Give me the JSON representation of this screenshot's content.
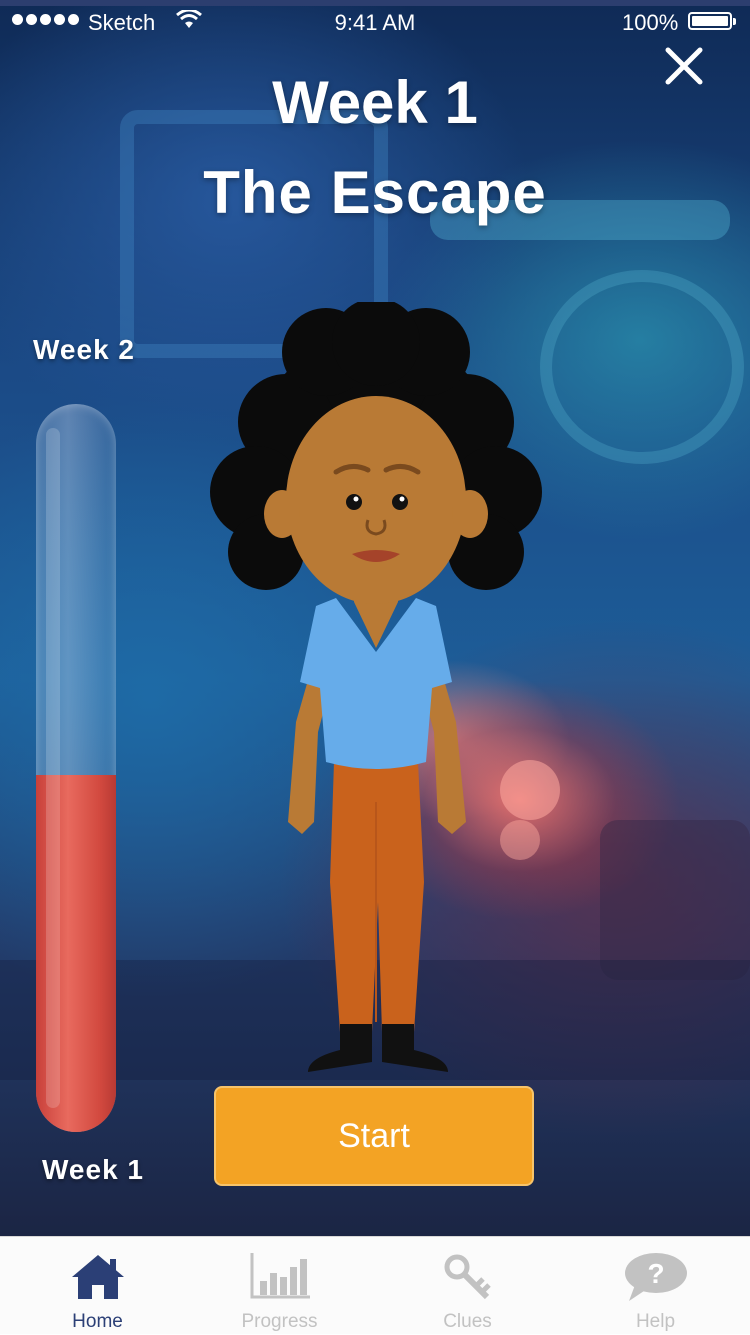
{
  "status_bar": {
    "carrier": "Sketch",
    "time": "9:41 AM",
    "battery": "100%"
  },
  "header": {
    "week": "Week 1",
    "episode": "The Escape"
  },
  "progress": {
    "top_label": "Week 2",
    "bottom_label": "Week 1",
    "fill_fraction": 0.49
  },
  "start_button": {
    "label": "Start"
  },
  "tabs": [
    {
      "label": "Home",
      "icon": "home-icon",
      "active": true
    },
    {
      "label": "Progress",
      "icon": "bar-chart-icon",
      "active": false
    },
    {
      "label": "Clues",
      "icon": "key-icon",
      "active": false
    },
    {
      "label": "Help",
      "icon": "help-bubble-icon",
      "active": false
    }
  ],
  "colors": {
    "accent": "#f3a324",
    "active_tab": "#2b3f76",
    "inactive_tab": "#c2c2c2",
    "progress_fill": "#e0554b"
  }
}
